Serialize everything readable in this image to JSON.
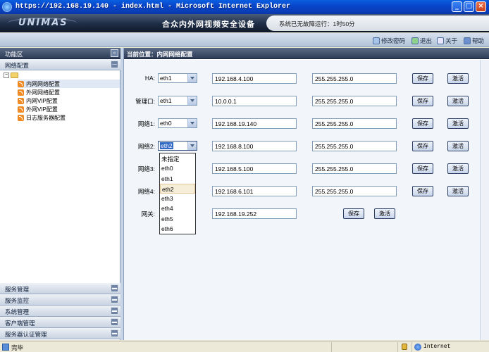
{
  "window": {
    "title": "https://192.168.19.140 - index.html - Microsoft Internet Explorer"
  },
  "header": {
    "logo": "UNIMAS",
    "app_title": "合众内外网视频安全设备",
    "uptime": "系统已无故障运行：1时50分"
  },
  "toolbar": {
    "items": [
      {
        "label": "修改密码",
        "icon": "key-icon"
      },
      {
        "label": "退出",
        "icon": "exit-icon"
      },
      {
        "label": "关于",
        "icon": "info-icon"
      },
      {
        "label": "帮助",
        "icon": "help-icon"
      }
    ]
  },
  "sidebar": {
    "function_area": "功能区",
    "network_config": "网络配置",
    "tree": [
      "内网网络配置",
      "外网网络配置",
      "内网VIP配置",
      "外网VIP配置",
      "日志服务器配置"
    ],
    "bottom_menus": [
      "服务管理",
      "服务监控",
      "系统管理",
      "客户端管理",
      "服务器认证管理"
    ]
  },
  "main": {
    "breadcrumb": "当前位置：内网网络配置",
    "save_label": "保存",
    "activate_label": "激活",
    "rows": [
      {
        "label": "HA:",
        "iface": "eth1",
        "ip": "192.168.4.100",
        "mask": "255.255.255.0"
      },
      {
        "label": "管理口:",
        "iface": "eth1",
        "ip": "10.0.0.1",
        "mask": "255.255.255.0"
      },
      {
        "label": "网络1:",
        "iface": "eth0",
        "ip": "192.168.19.140",
        "mask": "255.255.255.0"
      },
      {
        "label": "网络2:",
        "iface": "eth2",
        "ip": "192.168.8.100",
        "mask": "255.255.255.0"
      },
      {
        "label": "网络3:",
        "iface": "",
        "ip": "192.168.5.100",
        "mask": "255.255.255.0"
      },
      {
        "label": "网络4:",
        "iface": "",
        "ip": "192.168.6.101",
        "mask": "255.255.255.0"
      }
    ],
    "gateway": {
      "label": "网关:",
      "ip": "192.168.19.252"
    },
    "dropdown_options": [
      "未指定",
      "eth0",
      "eth1",
      "eth2",
      "eth3",
      "eth4",
      "eth5",
      "eth6"
    ]
  },
  "statusbar": {
    "status": "完毕",
    "zone": "Internet"
  }
}
